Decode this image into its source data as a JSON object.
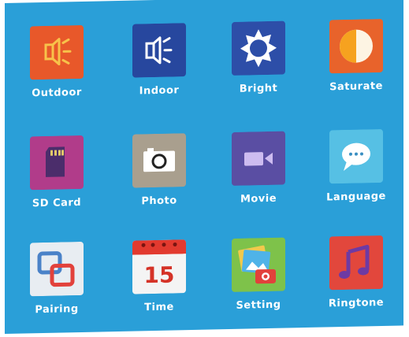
{
  "menu": {
    "items": [
      {
        "label": "Outdoor",
        "icon": "speaker-loud-icon",
        "color": "#e8582a"
      },
      {
        "label": "Indoor",
        "icon": "speaker-icon",
        "color": "#27479e"
      },
      {
        "label": "Bright",
        "icon": "sun-icon",
        "color": "#2d4ea8"
      },
      {
        "label": "Saturate",
        "icon": "contrast-circle-icon",
        "color": "#e8632b"
      },
      {
        "label": "SD Card",
        "icon": "sd-card-icon",
        "color": "#b13c8a"
      },
      {
        "label": "Photo",
        "icon": "camera-icon",
        "color": "#a99f8e"
      },
      {
        "label": "Movie",
        "icon": "video-camera-icon",
        "color": "#5a4ea3"
      },
      {
        "label": "Language",
        "icon": "chat-bubble-icon",
        "color": "#56c0e4"
      },
      {
        "label": "Pairing",
        "icon": "link-squares-icon",
        "color": "#e8edf2"
      },
      {
        "label": "Time",
        "icon": "calendar-icon",
        "date_number": "15",
        "color": "#e23a2f"
      },
      {
        "label": "Setting",
        "icon": "gallery-camera-icon",
        "color": "#7ec24a"
      },
      {
        "label": "Ringtone",
        "icon": "music-note-icon",
        "color": "#e2473c"
      }
    ]
  }
}
